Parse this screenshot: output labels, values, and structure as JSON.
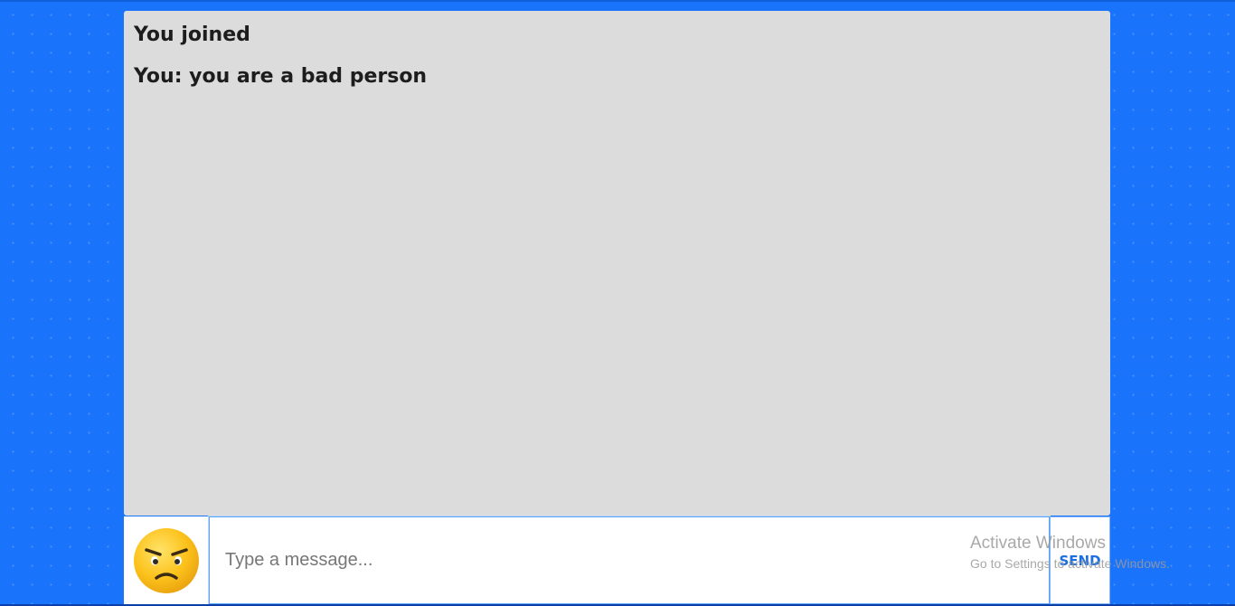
{
  "chat": {
    "messages": [
      {
        "text": "You joined"
      },
      {
        "text": "You: you are a bad person"
      }
    ]
  },
  "composer": {
    "emoji_icon": "angry-face-icon",
    "input_value": "",
    "input_placeholder": "Type a message...",
    "send_label": "SEND"
  },
  "watermark": {
    "title": "Activate Windows",
    "subtitle": "Go to Settings to activate Windows."
  },
  "colors": {
    "background": "#1a73fb",
    "chat_bg": "#dcdcdc",
    "accent": "#1b6fe0"
  }
}
